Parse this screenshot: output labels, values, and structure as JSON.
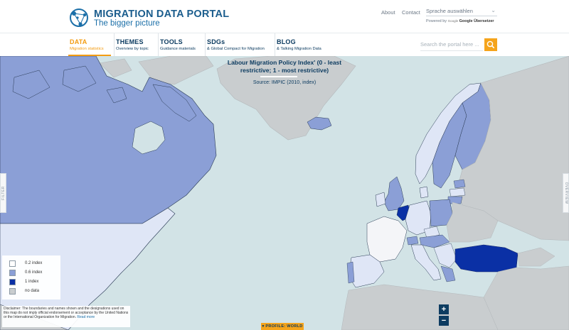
{
  "brand": {
    "title": "MIGRATION DATA PORTAL",
    "subtitle": "The bigger picture"
  },
  "top_links": {
    "about": "About",
    "contact": "Contact"
  },
  "language": {
    "label": "Sprache auswählen",
    "powered_by": "Powered by",
    "google_word": "Google",
    "translator": "Google Übersetzer"
  },
  "nav": [
    {
      "title": "DATA",
      "sub": "Migration statistics",
      "active": true
    },
    {
      "title": "THEMES",
      "sub": "Overview by topic",
      "active": false
    },
    {
      "title": "TOOLS",
      "sub": "Guidance materials",
      "active": false
    },
    {
      "title": "SDGs",
      "sub": "& Global Compact for Migration",
      "active": false
    },
    {
      "title": "BLOG",
      "sub": "& Talking Migration Data",
      "active": false
    }
  ],
  "search": {
    "placeholder": "Search the portal here ...",
    "icon": "search-icon"
  },
  "map": {
    "title_line1": "Labour Migration Policy Index' (0 - least",
    "title_line2": "restrictive; 1 - most restrictive)",
    "source": "Source: IMPIC (2010, index)",
    "filter_tab": "FILTER",
    "overview_tab": "OVERVIEW",
    "zoom_in": "+",
    "zoom_out": "−",
    "profile_button": "▾ PROFILE: WORLD"
  },
  "legend": [
    {
      "label": "0.2 index",
      "color": "#ffffff"
    },
    {
      "label": "0.6 index",
      "color": "#8b9fd6"
    },
    {
      "label": "1 index",
      "color": "#0a30a5"
    },
    {
      "label": "no data",
      "color": "#c9cdcf"
    }
  ],
  "disclaimer": {
    "text": "Disclaimer: The boundaries and names shown and the designations used on this map do not imply official endorsement or acceptance by the United Nations or the International Organization for Migration.",
    "more": "Read more"
  },
  "colors": {
    "accent": "#f39c12",
    "brand_blue": "#0d3c61",
    "ocean": "#d2e3e6",
    "no_data": "#c9cdcf"
  }
}
